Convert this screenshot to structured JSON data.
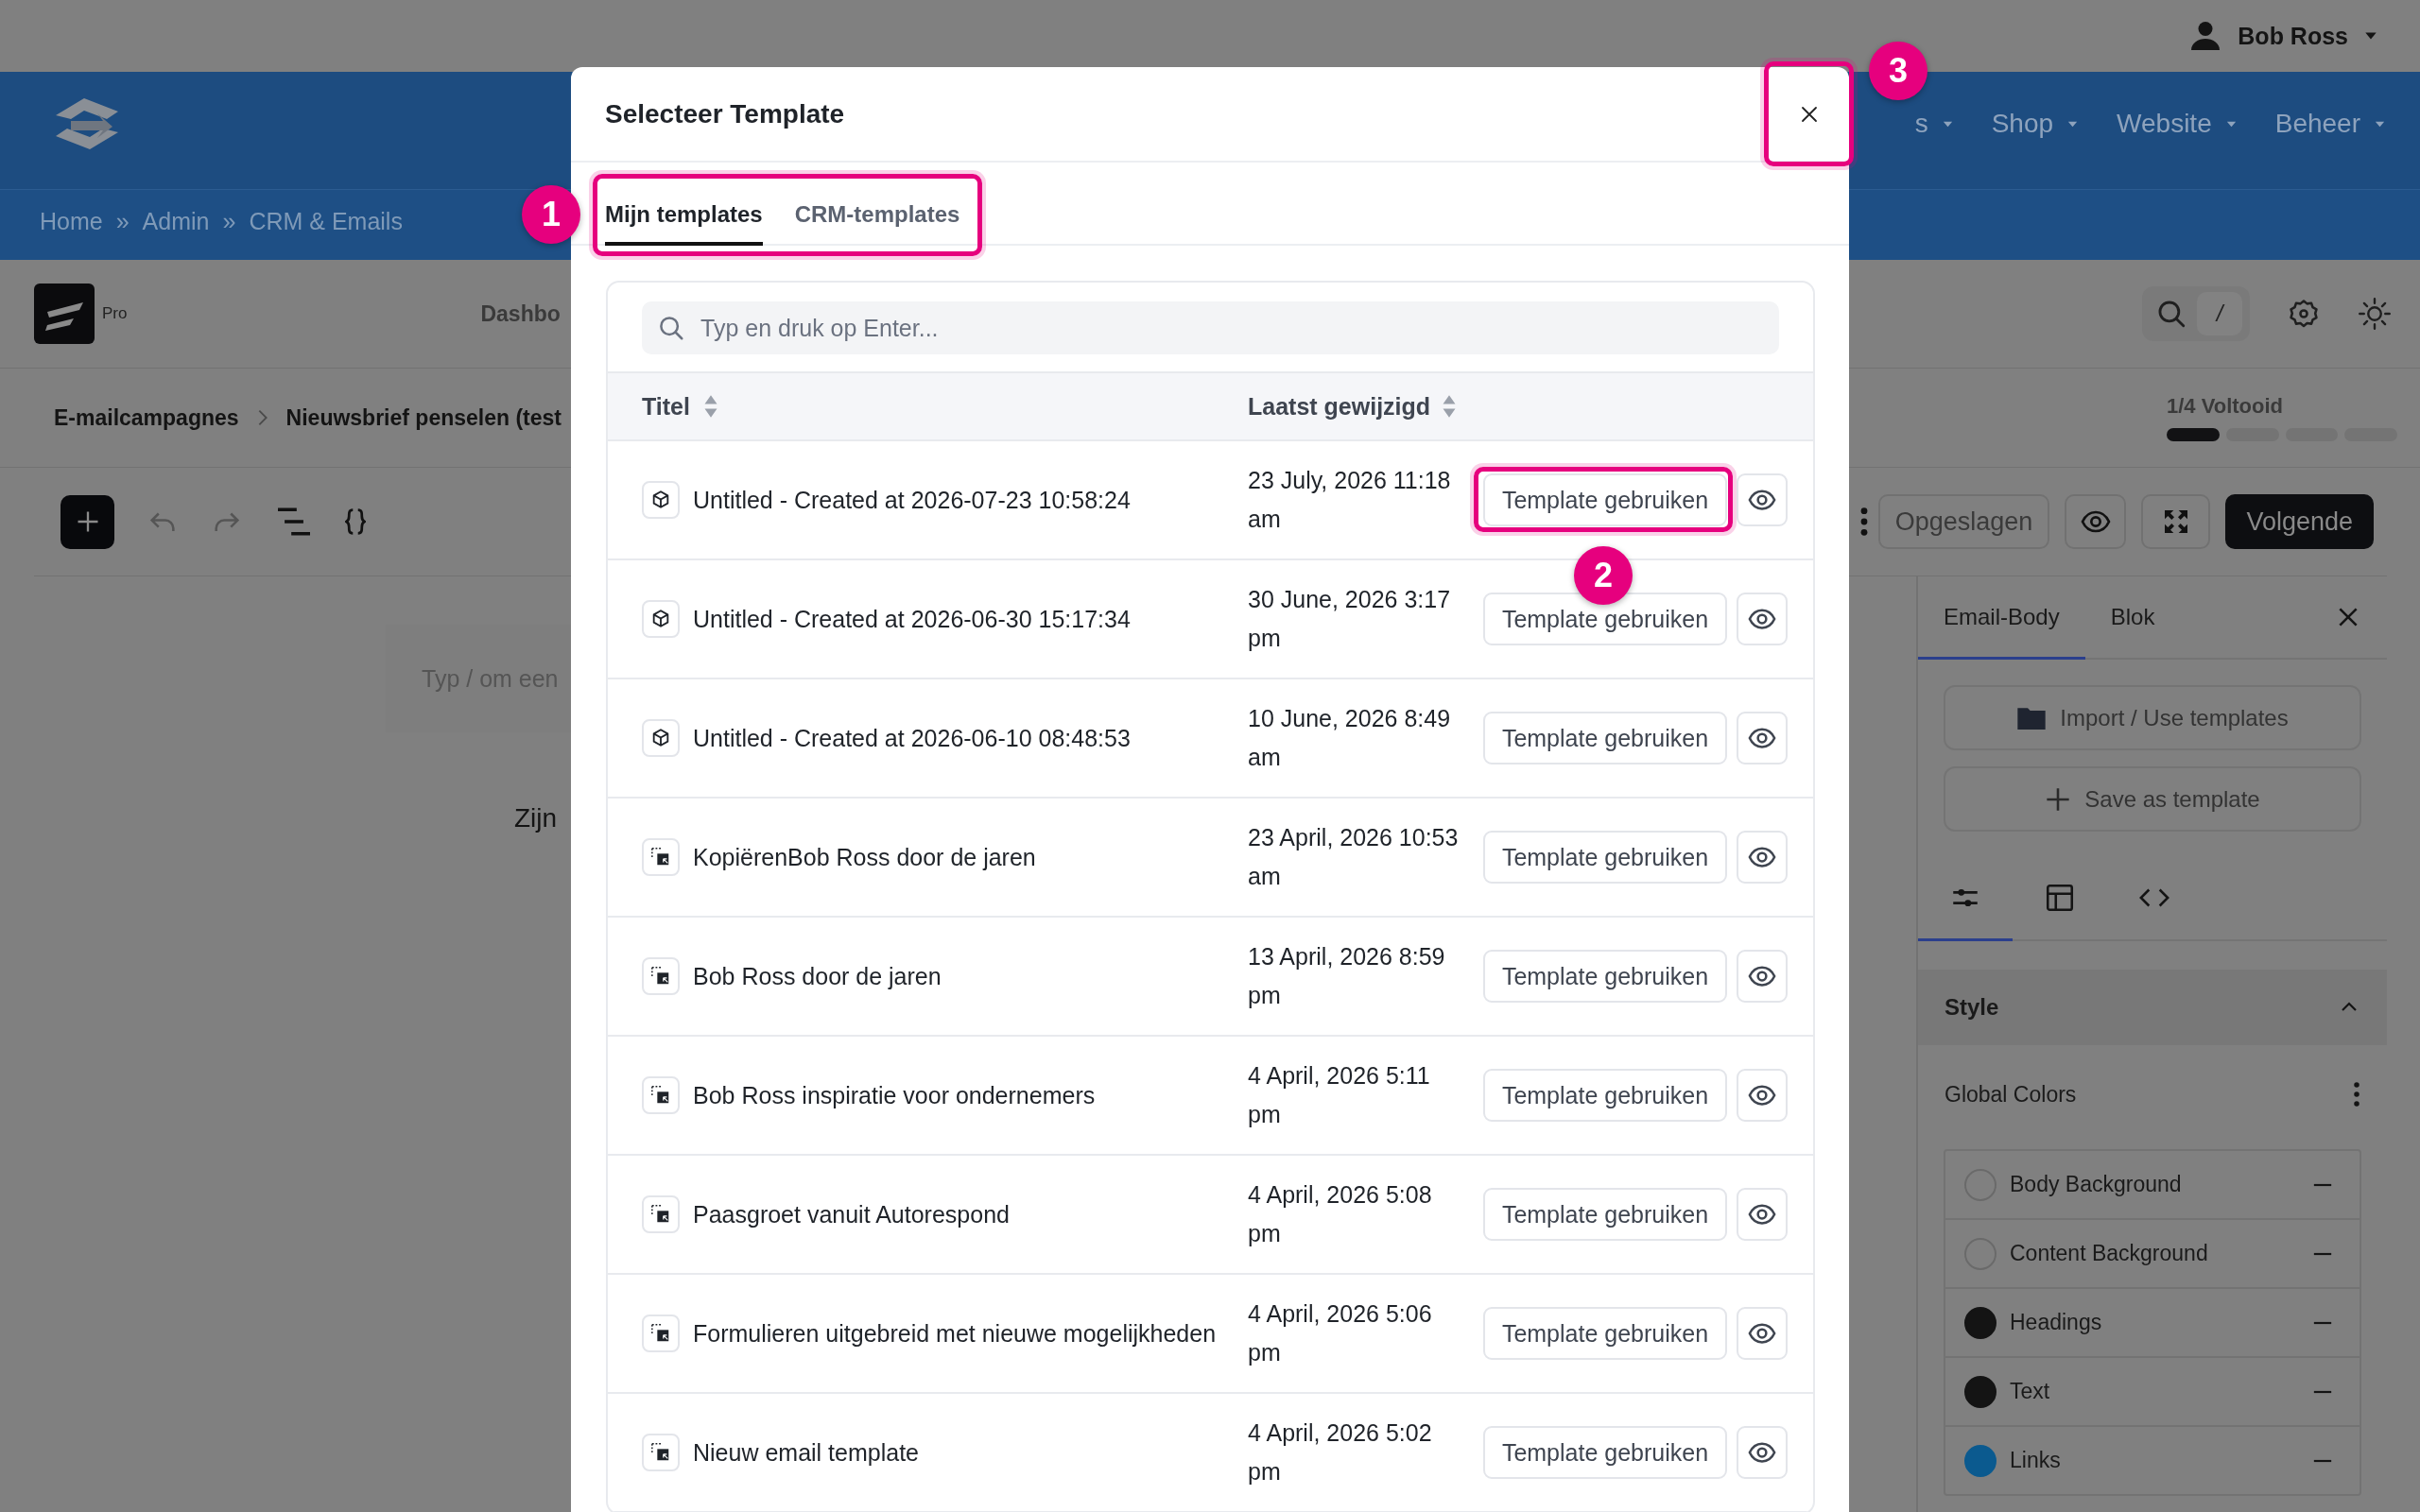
{
  "top_bar": {
    "user_name": "Bob Ross"
  },
  "main_nav": {
    "menus": [
      {
        "label": "s"
      },
      {
        "label": "Shop"
      },
      {
        "label": "Website"
      },
      {
        "label": "Beheer"
      }
    ]
  },
  "breadcrumb": {
    "separator": "»",
    "items": [
      "Home",
      "Admin",
      "CRM & Emails"
    ]
  },
  "editor_header": {
    "badge": "Pro",
    "nav_item": "Dashbo",
    "shortcut_key": "/"
  },
  "campaign_path": {
    "items": [
      "E-mailcampagnes",
      "Nieuwsbrief penselen (test"
    ],
    "progress_label": "1/4 Voltooid",
    "steps": [
      {
        "done": true
      },
      {
        "done": false
      },
      {
        "done": false
      },
      {
        "done": false
      }
    ]
  },
  "toolbar": {
    "saved_button": "Opgeslagen",
    "next_button": "Volgende"
  },
  "canvas": {
    "placeholder": "Typ / om een",
    "text": "Zijn"
  },
  "side_panel": {
    "tabs": [
      {
        "label": "Email-Body",
        "selected": true
      },
      {
        "label": "Blok",
        "selected": false
      }
    ],
    "buttons": [
      {
        "kind": "import",
        "label": "Import / Use templates"
      },
      {
        "kind": "save",
        "label": "Save as template"
      }
    ],
    "icon_tabs": [
      {
        "kind": "sliders",
        "selected": true
      },
      {
        "kind": "layout",
        "selected": false
      },
      {
        "kind": "code",
        "selected": false
      }
    ],
    "section": {
      "title": "Style",
      "expanded": true
    },
    "group_title": "Global Colors",
    "colors": [
      {
        "name": "Body Background",
        "color": "#808080"
      },
      {
        "name": "Content Background",
        "color": "#808080"
      },
      {
        "name": "Headings",
        "color": "#141414"
      },
      {
        "name": "Text",
        "color": "#141414"
      },
      {
        "name": "Links",
        "color": "#0b5a8f"
      }
    ]
  },
  "modal": {
    "title": "Selecteer Template",
    "tabs": [
      {
        "label": "Mijn templates",
        "selected": true
      },
      {
        "label": "CRM-templates",
        "selected": false
      }
    ],
    "search": {
      "placeholder": "Typ en druk op Enter..."
    },
    "columns": [
      {
        "label": "Titel",
        "sortable": true
      },
      {
        "label": "Laatst gewijzigd",
        "sortable": true
      }
    ],
    "rows": [
      {
        "kind": "cube",
        "title": "Untitled - Created at 2026-07-23 10:58:24",
        "modified": "23 July, 2026 11:18 am",
        "action": "Template gebruiken"
      },
      {
        "kind": "cube",
        "title": "Untitled - Created at 2026-06-30 15:17:34",
        "modified": "30 June, 2026 3:17 pm",
        "action": "Template gebruiken"
      },
      {
        "kind": "cube",
        "title": "Untitled - Created at 2026-06-10 08:48:53",
        "modified": "10 June, 2026 8:49 am",
        "action": "Template gebruiken"
      },
      {
        "kind": "copy",
        "title": "KopiërenBob Ross door de jaren",
        "modified": "23 April, 2026 10:53 am",
        "action": "Template gebruiken"
      },
      {
        "kind": "copy",
        "title": "Bob Ross door de jaren",
        "modified": "13 April, 2026 8:59 pm",
        "action": "Template gebruiken"
      },
      {
        "kind": "copy",
        "title": "Bob Ross inspiratie voor ondernemers",
        "modified": "4 April, 2026 5:11 pm",
        "action": "Template gebruiken"
      },
      {
        "kind": "copy",
        "title": "Paasgroet vanuit Autorespond",
        "modified": "4 April, 2026 5:08 pm",
        "action": "Template gebruiken"
      },
      {
        "kind": "copy",
        "title": "Formulieren uitgebreid met nieuwe mogelijkheden",
        "modified": "4 April, 2026 5:06 pm",
        "action": "Template gebruiken"
      },
      {
        "kind": "copy",
        "title": "Nieuw email template",
        "modified": "4 April, 2026 5:02 pm",
        "action": "Template gebruiken"
      }
    ]
  },
  "annotations": [
    {
      "label": "1"
    },
    {
      "label": "2"
    },
    {
      "label": "3"
    }
  ]
}
